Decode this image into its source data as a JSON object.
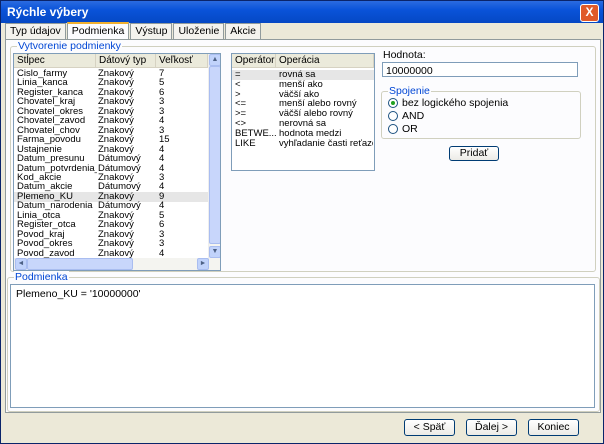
{
  "window": {
    "title": "Rýchle výbery",
    "close": "X"
  },
  "tabs": [
    {
      "label": "Typ údajov"
    },
    {
      "label": "Podmienka"
    },
    {
      "label": "Výstup"
    },
    {
      "label": "Uloženie"
    },
    {
      "label": "Akcie"
    }
  ],
  "condition_builder": {
    "group_label": "Vytvorenie podmienky",
    "columns_table": {
      "headers": [
        "Stĺpec",
        "Dátový typ",
        "Veľkosť"
      ],
      "rows": [
        [
          "Cislo_farmy",
          "Znakový",
          "7"
        ],
        [
          "Linia_kanca",
          "Znakový",
          "5"
        ],
        [
          "Register_kanca",
          "Znakový",
          "6"
        ],
        [
          "Chovatel_kraj",
          "Znakový",
          "3"
        ],
        [
          "Chovatel_okres",
          "Znakový",
          "3"
        ],
        [
          "Chovatel_zavod",
          "Znakový",
          "4"
        ],
        [
          "Chovatel_chov",
          "Znakový",
          "3"
        ],
        [
          "Farma_povodu",
          "Znakový",
          "15"
        ],
        [
          "Ustajnenie",
          "Znakový",
          "4"
        ],
        [
          "Datum_presunu",
          "Dátumový",
          "4"
        ],
        [
          "Datum_potvrdenia_pr...",
          "Dátumový",
          "4"
        ],
        [
          "Kod_akcie",
          "Znakový",
          "3"
        ],
        [
          "Datum_akcie",
          "Dátumový",
          "4"
        ],
        [
          "Plemeno_KU",
          "Znakový",
          "9"
        ],
        [
          "Datum_narodenia",
          "Dátumový",
          "4"
        ],
        [
          "Linia_otca",
          "Znakový",
          "5"
        ],
        [
          "Register_otca",
          "Znakový",
          "6"
        ],
        [
          "Povod_kraj",
          "Znakový",
          "3"
        ],
        [
          "Povod_okres",
          "Znakový",
          "3"
        ],
        [
          "Povod_zavod",
          "Znakový",
          "4"
        ]
      ],
      "selected_row": 13
    },
    "operators_table": {
      "headers": [
        "Operátor",
        "Operácia"
      ],
      "rows": [
        [
          "=",
          "rovná sa"
        ],
        [
          "<",
          "menší ako"
        ],
        [
          ">",
          "väčší ako"
        ],
        [
          "<=",
          "menší alebo rovný"
        ],
        [
          ">=",
          "väčší alebo rovný"
        ],
        [
          "<>",
          "nerovná sa"
        ],
        [
          "BETWE...",
          "hodnota medzi"
        ],
        [
          "LIKE",
          "vyhľadanie časti reťazca"
        ]
      ],
      "selected_row": 0
    },
    "value": {
      "label": "Hodnota:",
      "input_value": "10000000"
    },
    "connection": {
      "group_label": "Spojenie",
      "options": [
        "bez logického spojenia",
        "AND",
        "OR"
      ],
      "selected": 0
    },
    "add_button": "Pridať"
  },
  "condition": {
    "group_label": "Podmienka",
    "text": "Plemeno_KU = '10000000'"
  },
  "footer": {
    "back": "< Späť",
    "next": "Ďalej >",
    "finish": "Koniec"
  },
  "colors": {
    "titlebar": "#0a53d9",
    "group_label": "#0046d5",
    "tab_highlight": "#f0b030",
    "radio_dot": "#21a121"
  }
}
